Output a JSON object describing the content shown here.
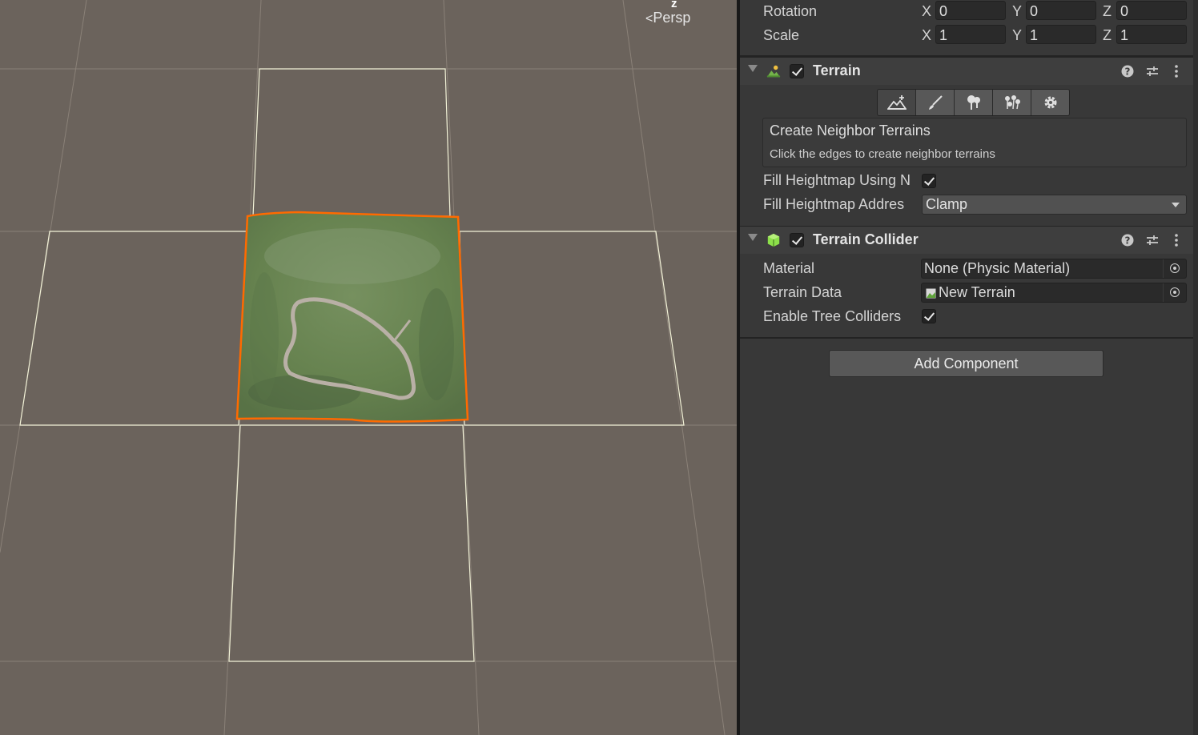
{
  "scene_view": {
    "gizmo_axis": "z",
    "projection_label": "Persp"
  },
  "transform": {
    "rotation": {
      "label": "Rotation",
      "x": "0",
      "y": "0",
      "z": "0"
    },
    "scale": {
      "label": "Scale",
      "x": "1",
      "y": "1",
      "z": "1"
    },
    "axis_labels": {
      "x": "X",
      "y": "Y",
      "z": "Z"
    }
  },
  "terrain": {
    "title": "Terrain",
    "enabled": true,
    "tools": [
      {
        "name": "create-neighbor-tool",
        "icon": "terrain-raise-icon",
        "active": true
      },
      {
        "name": "paint-tool",
        "icon": "brush-icon",
        "active": false
      },
      {
        "name": "paint-trees-tool",
        "icon": "trees-icon",
        "active": false
      },
      {
        "name": "paint-details-tool",
        "icon": "details-icon",
        "active": false
      },
      {
        "name": "settings-tool",
        "icon": "gear-icon",
        "active": false
      }
    ],
    "help_title": "Create Neighbor Terrains",
    "help_body": "Click the edges to create neighbor terrains",
    "fill_heightmap_label": "Fill Heightmap Using N",
    "fill_heightmap_checked": true,
    "fill_address_label": "Fill Heightmap Addres",
    "fill_address_value": "Clamp"
  },
  "terrain_collider": {
    "title": "Terrain Collider",
    "enabled": true,
    "material_label": "Material",
    "material_value": "None (Physic Material)",
    "terrain_data_label": "Terrain Data",
    "terrain_data_value": "New Terrain",
    "tree_colliders_label": "Enable Tree Colliders",
    "tree_colliders_checked": true
  },
  "add_component_label": "Add Component",
  "colors": {
    "scene_bg": "#6b635c",
    "selection_outline": "#ff6a00",
    "terrain_green": "#6a8653",
    "inspector_bg": "#383838"
  }
}
